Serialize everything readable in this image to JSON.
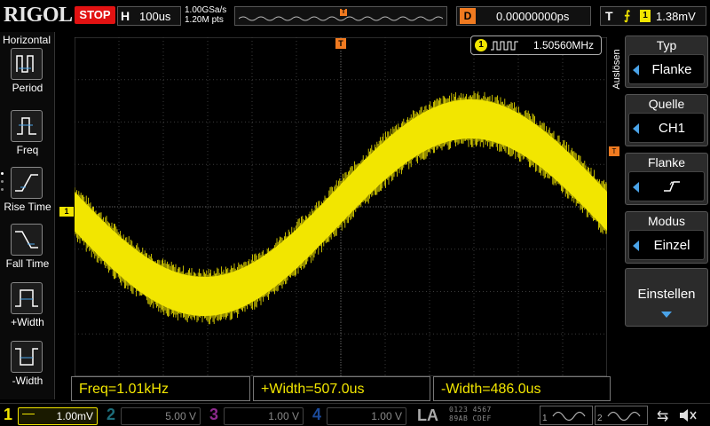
{
  "topbar": {
    "brand": "RIGOL",
    "run_status": "STOP",
    "horizontal_key": "H",
    "timebase": "100us",
    "sample_rate": "1.00GSa/s",
    "memory_depth": "1.20M pts",
    "trigger_pos_marker": "T",
    "delay_key": "D",
    "delay_value": "0.00000000ps",
    "trigger_key": "T",
    "trigger_edge_symbol": "⨍",
    "trigger_source_badge": "1",
    "trigger_level": "1.38mV"
  },
  "left_menu": {
    "title": "Horizontal",
    "items": [
      {
        "label": "Period",
        "icon": "period-icon"
      },
      {
        "label": "Freq",
        "icon": "frequency-icon"
      },
      {
        "label": "Rise Time",
        "icon": "rise-time-icon"
      },
      {
        "label": "Fall Time",
        "icon": "fall-time-icon"
      },
      {
        "label": "+Width",
        "icon": "positive-width-icon"
      },
      {
        "label": "-Width",
        "icon": "negative-width-icon"
      }
    ]
  },
  "display": {
    "ch1_marker": "1",
    "trigger_time_marker": "T",
    "trigger_level_marker": "T",
    "freq_counter_channel": "1",
    "freq_counter_value": "1.50560MHz",
    "waveform_color": "#f2e600"
  },
  "right_menu": {
    "side_title": "Auslösen",
    "blocks": [
      {
        "head": "Typ",
        "value": "Flanke"
      },
      {
        "head": "Quelle",
        "value": "CH1"
      },
      {
        "head": "Flanke",
        "value": "rising-edge-icon"
      },
      {
        "head": "Modus",
        "value": "Einzel"
      }
    ],
    "settings_label": "Einstellen"
  },
  "measurements": {
    "freq": "Freq=1.01kHz",
    "pos_width": "+Width=507.0us",
    "neg_width": "-Width=486.0us"
  },
  "bottombar": {
    "channels": [
      {
        "num": "1",
        "scale": "1.00mV",
        "color": "#f2e600"
      },
      {
        "num": "2",
        "scale": "5.00 V",
        "color": "#1d6d7a"
      },
      {
        "num": "3",
        "scale": "1.00 V",
        "color": "#8e2a8e"
      },
      {
        "num": "4",
        "scale": "1.00 V",
        "color": "#1b4a9a"
      }
    ],
    "la_label": "LA",
    "la_bits_top": "0123 4567",
    "la_bits_mid": "89AB CDEF",
    "la_bits_bot": "0001 2345",
    "src1_num": "1",
    "src2_num": "2",
    "usb_icon": "usb-icon",
    "speaker_icon": "speaker-mute-icon"
  }
}
